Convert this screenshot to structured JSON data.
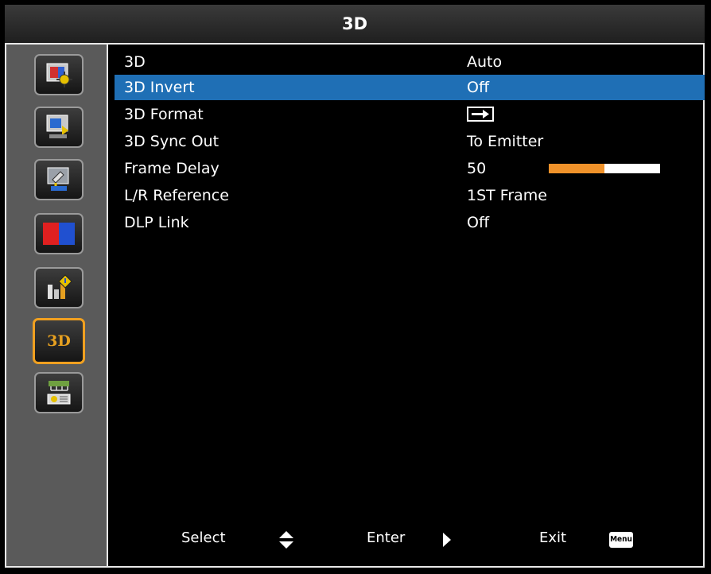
{
  "window": {
    "title": "3D"
  },
  "sidebar": {
    "items": [
      {
        "name": "image-settings",
        "icon": "image-settings-icon",
        "active": false
      },
      {
        "name": "display-settings",
        "icon": "display-settings-icon",
        "active": false
      },
      {
        "name": "setup",
        "icon": "setup-icon",
        "active": false
      },
      {
        "name": "color-3d",
        "icon": "color-blocks-icon",
        "active": false
      },
      {
        "name": "information",
        "icon": "info-bars-icon",
        "active": false
      },
      {
        "name": "3d",
        "icon": "3d-icon",
        "label": "3D",
        "active": true
      },
      {
        "name": "network",
        "icon": "network-icon",
        "active": false
      }
    ]
  },
  "menu": {
    "rows": [
      {
        "label": "3D",
        "value": "Auto"
      },
      {
        "label": "3D Invert",
        "value": "Off",
        "selected": true
      },
      {
        "label": "3D Format",
        "value": "",
        "icon": "arrow-right-icon"
      },
      {
        "label": "3D Sync Out",
        "value": "To Emitter"
      },
      {
        "label": "Frame Delay",
        "value": "50",
        "slider_fraction": 0.5
      },
      {
        "label": "L/R Reference",
        "value": "1ST Frame"
      },
      {
        "label": "DLP Link",
        "value": "Off"
      }
    ]
  },
  "footer": {
    "select_label": "Select",
    "enter_label": "Enter",
    "exit_label": "Exit",
    "menu_key": "Menu"
  },
  "colors": {
    "selected_row": "#1f6fb5",
    "slider_fill": "#f0922a",
    "active_border": "#f0a020"
  }
}
